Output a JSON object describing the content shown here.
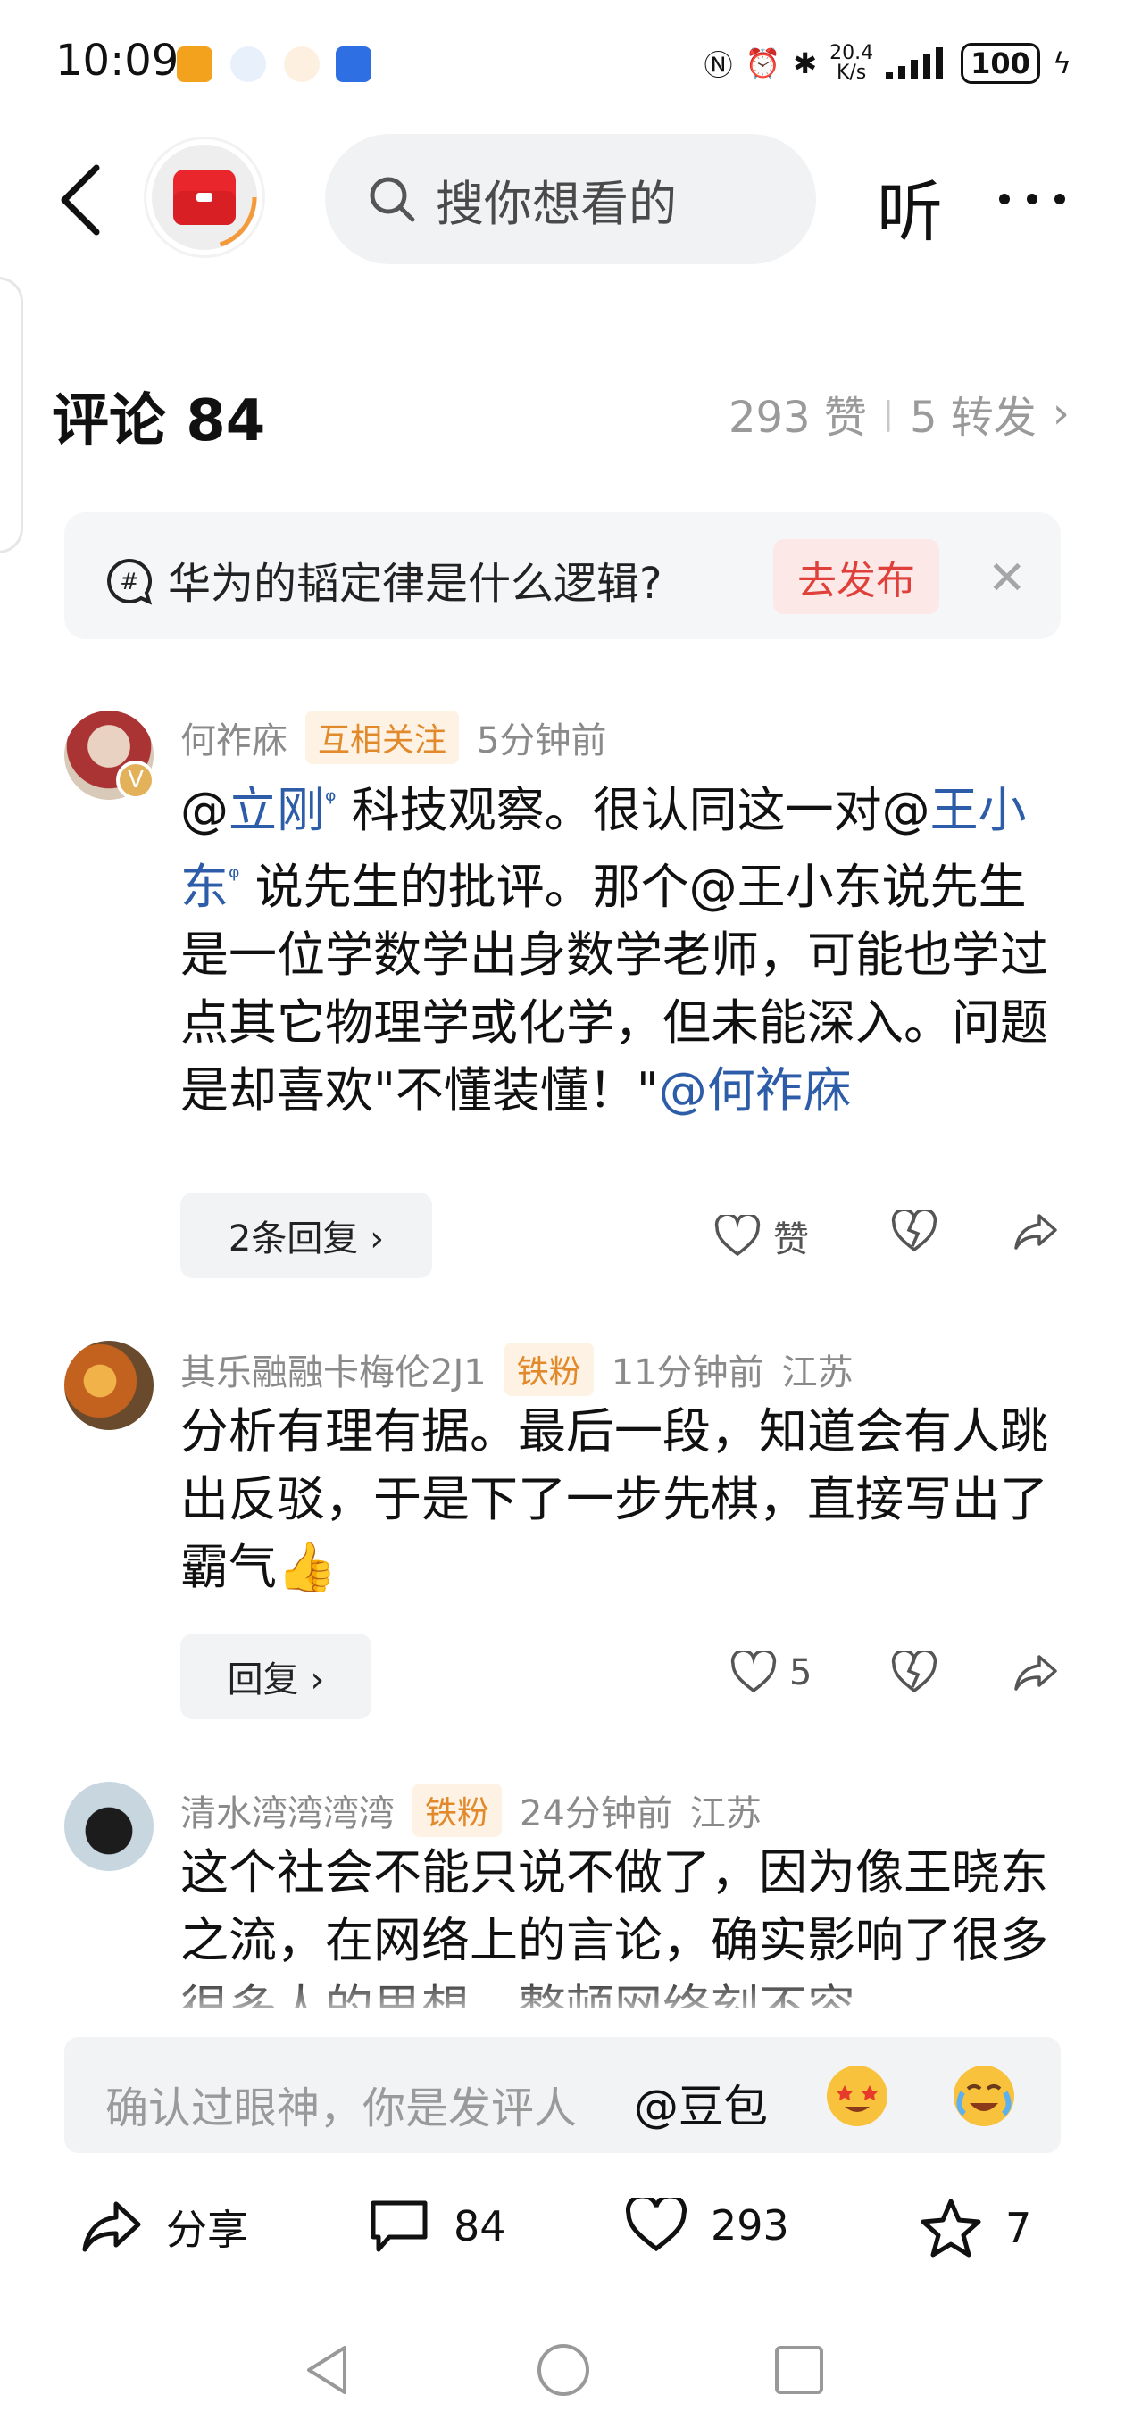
{
  "status_bar": {
    "time": "10:09",
    "net_speed_top": "20.4",
    "net_speed_bottom": "K/s",
    "battery": "100"
  },
  "nav": {
    "search_placeholder": "搜你想看的",
    "listen_label": "听"
  },
  "comments_header": {
    "title": "评论 84",
    "likes": "293 赞",
    "separator": "|",
    "shares": "5 转发"
  },
  "topic": {
    "question": "华为的韬定律是什么逻辑?",
    "publish_label": "去发布"
  },
  "comments": [
    {
      "author": "何祚庥",
      "badge": "互相关注",
      "time": "5分钟前",
      "location": "",
      "seg1": "@",
      "mention1": "立刚",
      "seg2": " 科技观察。很认同这一对@",
      "mention2": "王小东",
      "seg3": " 说先生的批评。那个@王小东说先生是一位学数学出身数学老师，可能也学过点其它物理学或化学，但未能深入。问题是却喜欢\"不懂装懂！\"",
      "mention3": "@何祚庥",
      "reply_label": "2条回复 ›",
      "like_label": "赞"
    },
    {
      "author": "其乐融融卡梅伦2J1",
      "badge": "铁粉",
      "time": "11分钟前",
      "location": "江苏",
      "text": "分析有理有据。最后一段，知道会有人跳出反驳，于是下了一步先棋，直接写出了霸气",
      "emoji": "👍",
      "reply_label": "回复 ›",
      "like_count": "5"
    },
    {
      "author": "清水湾湾湾湾",
      "badge": "铁粉",
      "time": "24分钟前",
      "location": "江苏",
      "text": "这个社会不能只说不做了，因为像王晓东之流，在网络上的言论，确实影响了很多很多人的思想，整顿网络刻不容"
    }
  ],
  "input_bar": {
    "placeholder": "确认过眼神，你是发评人",
    "mention": "@豆包"
  },
  "bottom_bar": {
    "share_label": "分享",
    "comment_count": "84",
    "like_count": "293",
    "star_count": "7"
  },
  "colors": {
    "link": "#2d5ca8",
    "accent_red": "#e0403a",
    "badge_orange": "#e28a2b"
  }
}
